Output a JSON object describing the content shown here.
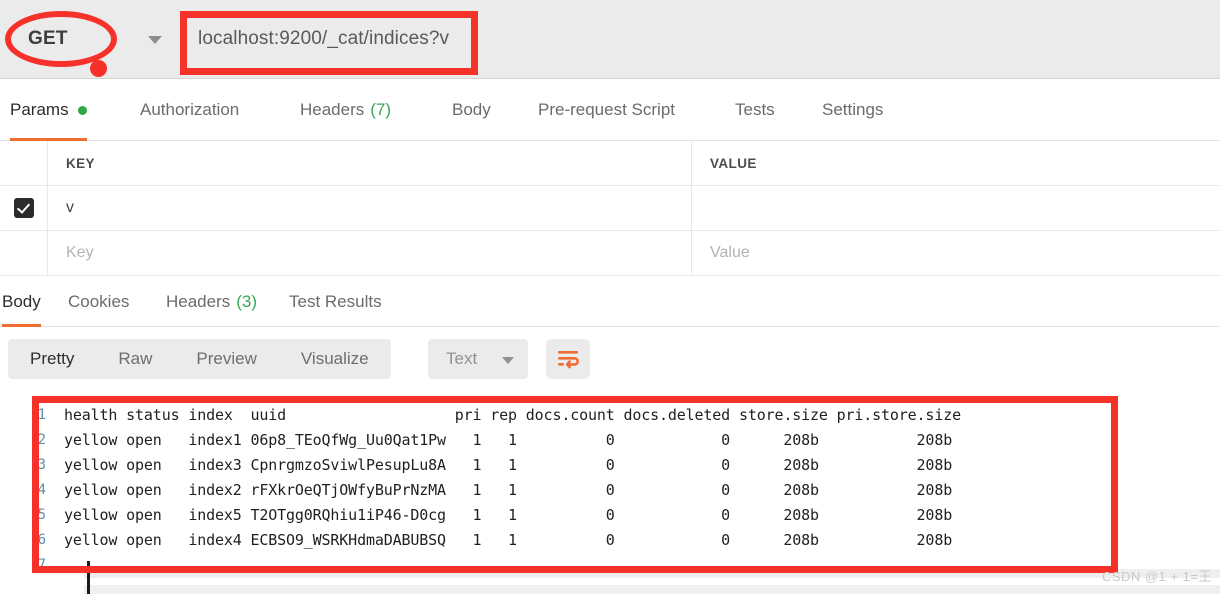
{
  "request": {
    "method": "GET",
    "url": "localhost:9200/_cat/indices?v",
    "method_caret_icon": "chevron-down-icon"
  },
  "request_tabs": [
    {
      "label": "Params",
      "badge": "",
      "dot": true,
      "active": true
    },
    {
      "label": "Authorization",
      "badge": "",
      "dot": false,
      "active": false
    },
    {
      "label": "Headers",
      "badge": "(7)",
      "dot": false,
      "active": false
    },
    {
      "label": "Body",
      "badge": "",
      "dot": false,
      "active": false
    },
    {
      "label": "Pre-request Script",
      "badge": "",
      "dot": false,
      "active": false
    },
    {
      "label": "Tests",
      "badge": "",
      "dot": false,
      "active": false
    },
    {
      "label": "Settings",
      "badge": "",
      "dot": false,
      "active": false
    }
  ],
  "params_table": {
    "columns": [
      "KEY",
      "VALUE"
    ],
    "rows": [
      {
        "checked": true,
        "key": "v",
        "value": ""
      }
    ],
    "placeholder_row": {
      "key": "Key",
      "value": "Value"
    }
  },
  "response_tabs": [
    {
      "label": "Body",
      "badge": "",
      "active": true
    },
    {
      "label": "Cookies",
      "badge": "",
      "active": false
    },
    {
      "label": "Headers",
      "badge": "(3)",
      "active": false
    },
    {
      "label": "Test Results",
      "badge": "",
      "active": false
    }
  ],
  "response_toolbar": {
    "view_modes": [
      "Pretty",
      "Raw",
      "Preview",
      "Visualize"
    ],
    "selected_view": "Pretty",
    "format": "Text",
    "format_caret_icon": "chevron-down-icon",
    "wrap_button_icon": "word-wrap-icon"
  },
  "response_body": {
    "lines": [
      {
        "num": "1",
        "text": "health status index  uuid                   pri rep docs.count docs.deleted store.size pri.store.size"
      },
      {
        "num": "2",
        "text": "yellow open   index1 06p8_TEoQfWg_Uu0Qat1Pw   1   1          0            0      208b           208b"
      },
      {
        "num": "3",
        "text": "yellow open   index3 CpnrgmzoSviwlPesupLu8A   1   1          0            0      208b           208b"
      },
      {
        "num": "4",
        "text": "yellow open   index2 rFXkrOeQTjOWfyBuPrNzMA   1   1          0            0      208b           208b"
      },
      {
        "num": "5",
        "text": "yellow open   index5 T2OTgg0RQhiu1iP46-D0cg   1   1          0            0      208b           208b"
      },
      {
        "num": "6",
        "text": "yellow open   index4 ECBSO9_WSRKHdmaDABUBSQ   1   1          0            0      208b           208b"
      },
      {
        "num": "7",
        "text": ""
      }
    ]
  },
  "annotations": {
    "color": "#f6312a",
    "ellipse_target": "GET",
    "rect_url_target": "localhost:9200/_cat/indices?v",
    "rect_body_target": "response-body"
  },
  "watermark": "CSDN @1 + 1=王"
}
